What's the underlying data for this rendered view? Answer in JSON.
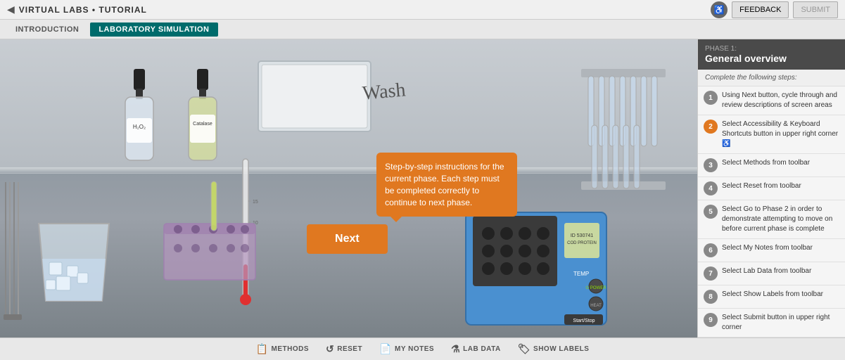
{
  "header": {
    "back_icon": "◀",
    "title": "VIRTUAL LABS • TUTORIAL",
    "accessibility_icon": "♿",
    "feedback_label": "FEEDBACK",
    "submit_label": "SUBMIT"
  },
  "nav": {
    "tabs": [
      {
        "id": "intro",
        "label": "INTRODUCTION",
        "active": false
      },
      {
        "id": "lab",
        "label": "LABORATORY SIMULATION",
        "active": true
      }
    ]
  },
  "lab": {
    "wash_label": "Wash",
    "tooltip_text": "Step-by-step instructions for the current phase. Each step must be completed correctly to continue to next phase.",
    "next_button": "Next",
    "bottle1_label": "H₂O₂",
    "bottle2_label": "Catalase"
  },
  "right_panel": {
    "phase_label": "PHASE 1:",
    "phase_title": "General overview",
    "steps_intro": "Complete the following steps:",
    "steps": [
      {
        "num": 1,
        "text": "Using Next button, cycle through and review descriptions of screen areas",
        "active": false
      },
      {
        "num": 2,
        "text": "Select Accessibility & Keyboard Shortcuts button in upper right corner ♿",
        "active": true
      },
      {
        "num": 3,
        "text": "Select Methods from toolbar",
        "active": false
      },
      {
        "num": 4,
        "text": "Select Reset from toolbar",
        "active": false
      },
      {
        "num": 5,
        "text": "Select Go to Phase 2 in order to demonstrate attempting to move on before current phase is complete",
        "active": false
      },
      {
        "num": 6,
        "text": "Select My Notes from toolbar",
        "active": false
      },
      {
        "num": 7,
        "text": "Select Lab Data from toolbar",
        "active": false
      },
      {
        "num": 8,
        "text": "Select Show Labels from toolbar",
        "active": false
      },
      {
        "num": 9,
        "text": "Select Submit button in upper right corner",
        "active": false
      }
    ]
  },
  "toolbar": {
    "items": [
      {
        "id": "methods",
        "icon": "📋",
        "label": "METHODS"
      },
      {
        "id": "reset",
        "icon": "↺",
        "label": "RESET"
      },
      {
        "id": "mynotes",
        "icon": "📄",
        "label": "MY NOTES"
      },
      {
        "id": "labdata",
        "icon": "⚗",
        "label": "LAB DATA"
      },
      {
        "id": "showlabels",
        "icon": "🏷",
        "label": "SHOW LABELS"
      }
    ]
  },
  "colors": {
    "accent": "#e07820",
    "teal": "#006b6b",
    "dark_panel": "#4a4a4a"
  }
}
